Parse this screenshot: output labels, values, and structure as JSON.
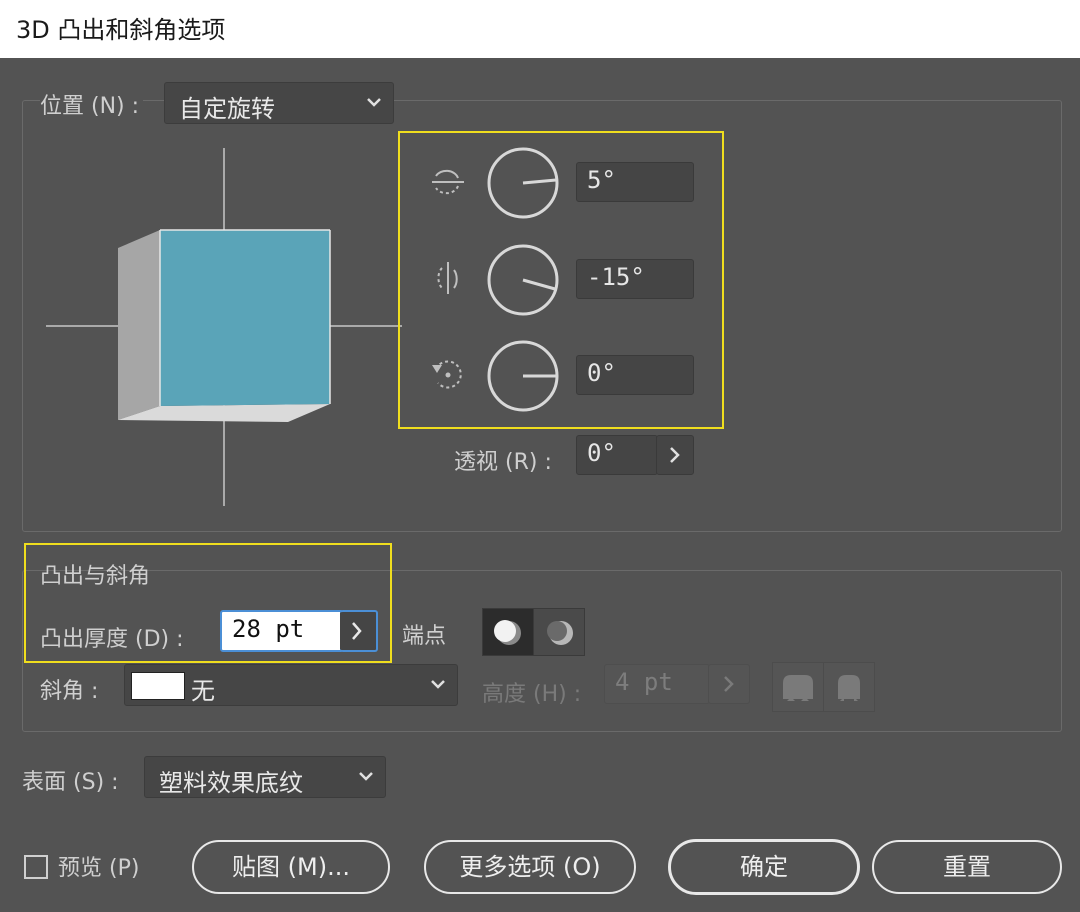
{
  "window": {
    "title": "3D 凸出和斜角选项"
  },
  "position": {
    "label": "位置",
    "mnemonic": "(N)",
    "colon": ":",
    "preset": "自定旋转",
    "rotation_x": "5°",
    "rotation_y": "-15°",
    "rotation_z": "0°",
    "perspective_label": "透视",
    "perspective_mnemonic": "(R)",
    "perspective_value": "0°"
  },
  "extrude": {
    "section_title": "凸出与斜角",
    "depth_label": "凸出厚度",
    "depth_mnemonic": "(D)",
    "depth_value": "28 pt",
    "cap_label": "端点",
    "bevel_label": "斜角",
    "bevel_value": "无",
    "height_label": "高度",
    "height_mnemonic": "(H)",
    "height_value": "4 pt"
  },
  "surface": {
    "label": "表面",
    "mnemonic": "(S)",
    "value": "塑料效果底纹"
  },
  "footer": {
    "preview_label": "预览",
    "preview_mnemonic": "(P)",
    "preview_checked": false,
    "map_button": "贴图 (M)...",
    "more_button": "更多选项 (O)",
    "ok_button": "确定",
    "reset_button": "重置"
  },
  "colors": {
    "cube_front": "#5aa4b8",
    "highlight": "#f0de1e",
    "background": "#535353"
  }
}
